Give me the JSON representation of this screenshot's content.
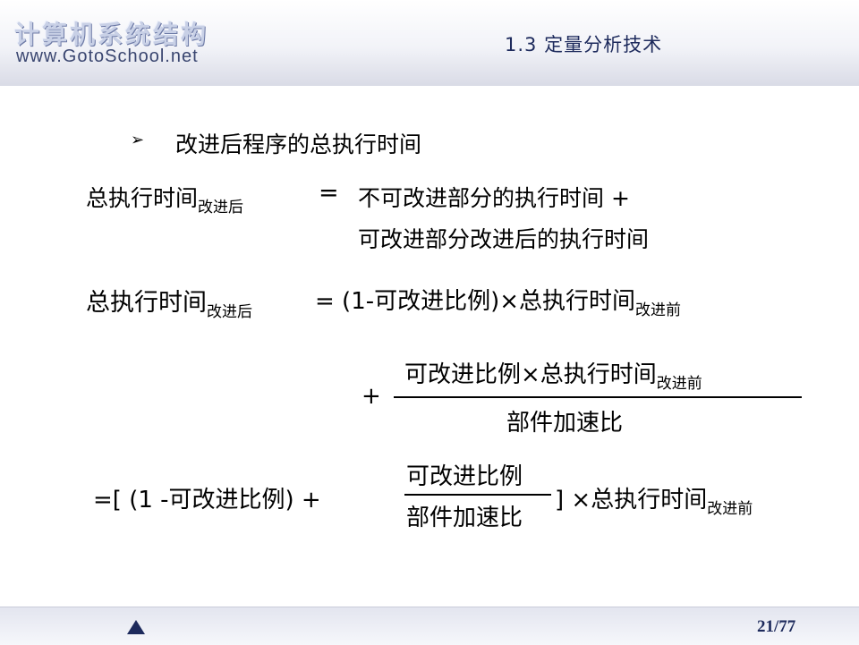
{
  "header": {
    "logo_title": "计算机系统结构",
    "logo_url": "www.GotoSchool.net",
    "section_title": "1.3 定量分析技术"
  },
  "bullet": {
    "marker": "➢",
    "text": "改进后程序的总执行时间"
  },
  "eq1": {
    "lhs": "总执行时间",
    "lhs_sub": "改进后",
    "equals": "=",
    "rhs_line1": "不可改进部分的执行时间  +",
    "rhs_line2": "可改进部分改进后的执行时间"
  },
  "eq2": {
    "lhs": "总执行时间",
    "lhs_sub": "改进后",
    "rhs": "= (1-可改进比例)×总执行时间",
    "rhs_sub": "改进前"
  },
  "eq3": {
    "plus": "+",
    "numerator": "可改进比例×总执行时间",
    "numerator_sub": "改进前",
    "denominator": "部件加速比"
  },
  "eq4": {
    "prefix": "=[ (1 -可改进比例) +",
    "numerator": "可改进比例",
    "denominator": "部件加速比",
    "suffix": "] ×总执行时间",
    "suffix_sub": "改进前"
  },
  "footer": {
    "page": "21/77"
  }
}
